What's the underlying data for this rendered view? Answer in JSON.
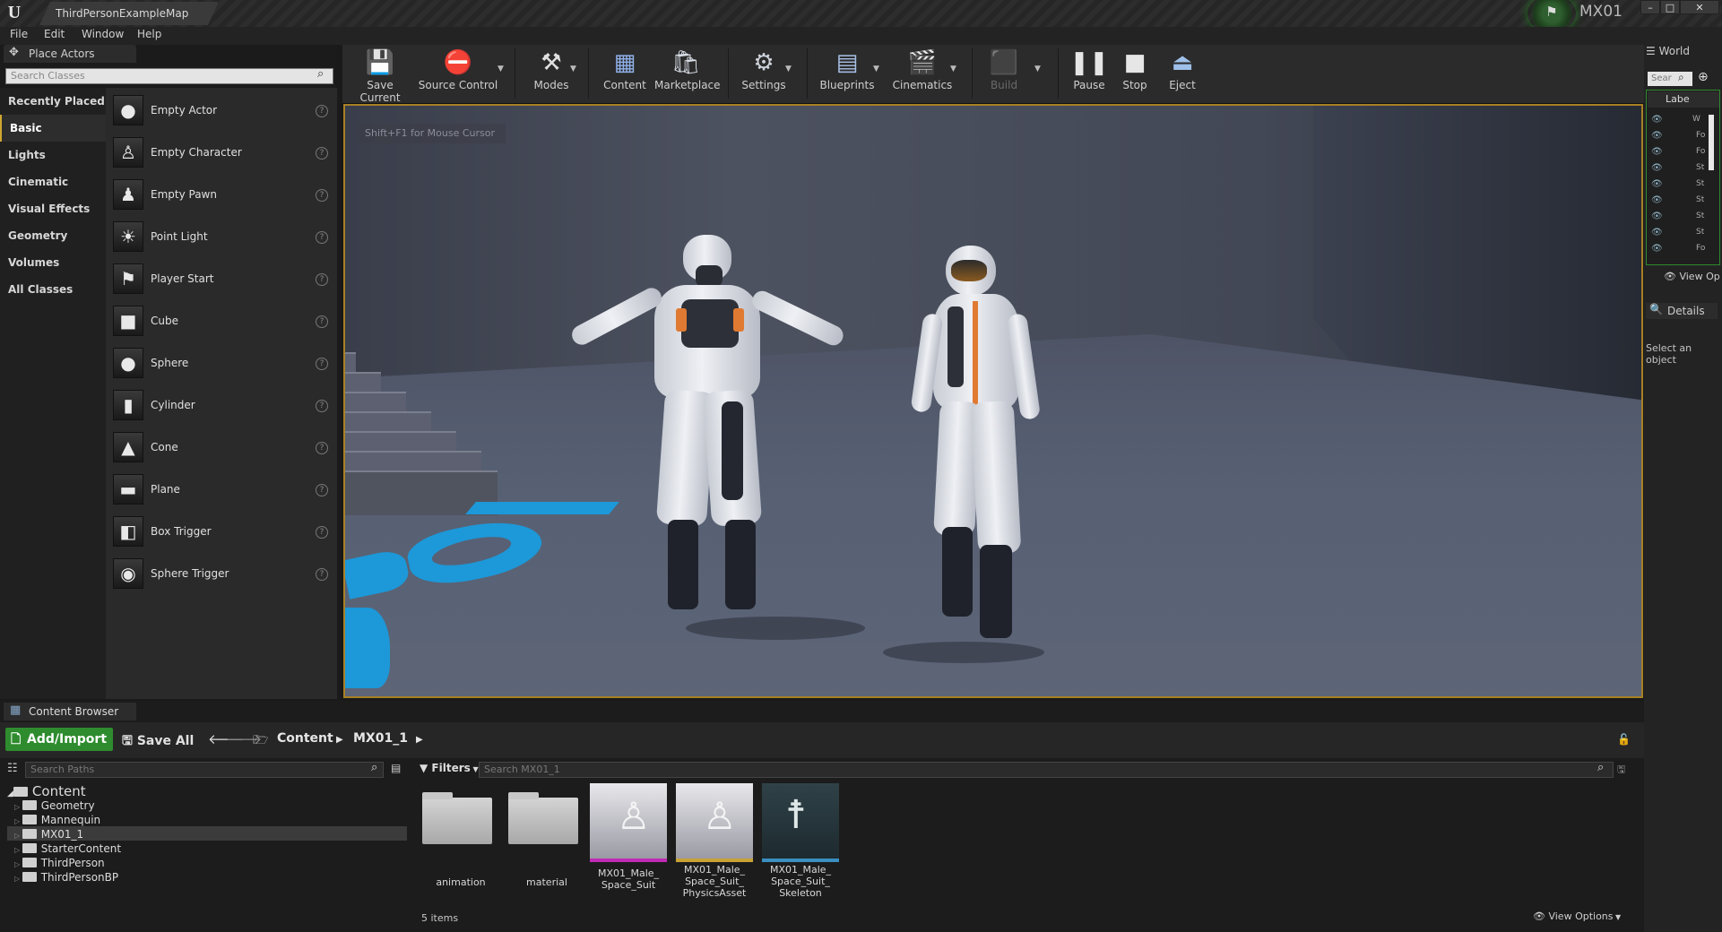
{
  "window": {
    "doc_tab": "ThirdPersonExampleMap",
    "project_name": "MX01",
    "controls": [
      "–",
      "□",
      "✕"
    ]
  },
  "menu": [
    "File",
    "Edit",
    "Window",
    "Help"
  ],
  "place_actors": {
    "tab_label": "Place Actors",
    "search_placeholder": "Search Classes",
    "categories": [
      "Recently Placed",
      "Basic",
      "Lights",
      "Cinematic",
      "Visual Effects",
      "Geometry",
      "Volumes",
      "All Classes"
    ],
    "selected_category": "Basic",
    "actors": [
      {
        "label": "Empty Actor",
        "icon": "sphere-icon"
      },
      {
        "label": "Empty Character",
        "icon": "character-icon"
      },
      {
        "label": "Empty Pawn",
        "icon": "pawn-icon"
      },
      {
        "label": "Point Light",
        "icon": "light-bulb-icon"
      },
      {
        "label": "Player Start",
        "icon": "player-start-icon"
      },
      {
        "label": "Cube",
        "icon": "cube-icon"
      },
      {
        "label": "Sphere",
        "icon": "sphere-icon"
      },
      {
        "label": "Cylinder",
        "icon": "cylinder-icon"
      },
      {
        "label": "Cone",
        "icon": "cone-icon"
      },
      {
        "label": "Plane",
        "icon": "plane-icon"
      },
      {
        "label": "Box Trigger",
        "icon": "box-trigger-icon"
      },
      {
        "label": "Sphere Trigger",
        "icon": "sphere-trigger-icon"
      }
    ]
  },
  "toolbar": {
    "items": [
      {
        "label": "Save Current",
        "icon": "save-icon"
      },
      {
        "label": "Source Control",
        "icon": "source-control-icon"
      },
      {
        "label": "Modes",
        "icon": "modes-icon"
      },
      {
        "label": "Content",
        "icon": "content-icon"
      },
      {
        "label": "Marketplace",
        "icon": "marketplace-icon"
      },
      {
        "label": "Settings",
        "icon": "settings-icon"
      },
      {
        "label": "Blueprints",
        "icon": "blueprints-icon"
      },
      {
        "label": "Cinematics",
        "icon": "cinematics-icon"
      },
      {
        "label": "Build",
        "icon": "build-icon"
      },
      {
        "label": "Pause",
        "icon": "pause-icon"
      },
      {
        "label": "Stop",
        "icon": "stop-icon"
      },
      {
        "label": "Eject",
        "icon": "eject-icon"
      }
    ]
  },
  "viewport": {
    "hint": "Shift+F1 for Mouse Cursor"
  },
  "world_outliner": {
    "tab_label": "World",
    "search_placeholder": "Sear",
    "column_label": "Labe",
    "rows": [
      "W",
      "Fo",
      "Fo",
      "St",
      "St",
      "St",
      "St",
      "St",
      "Fo"
    ],
    "view_options": "View Op"
  },
  "details": {
    "tab_label": "Details",
    "hint": "Select an object"
  },
  "content_browser": {
    "tab_label": "Content Browser",
    "add_import": "Add/Import",
    "save_all": "Save All",
    "breadcrumb": [
      "Content",
      "MX01_1"
    ],
    "path_search_placeholder": "Search Paths",
    "filters_label": "Filters",
    "asset_search_placeholder": "Search MX01_1",
    "tree_root": "Content",
    "tree": [
      "Geometry",
      "Mannequin",
      "MX01_1",
      "StarterContent",
      "ThirdPerson",
      "ThirdPersonBP"
    ],
    "selected_folder": "MX01_1",
    "assets": [
      {
        "name": "animation",
        "kind": "folder"
      },
      {
        "name": "material",
        "kind": "folder"
      },
      {
        "name": "MX01_Male_ Space_Suit",
        "kind": "skeletal-mesh",
        "accent": "#c02ab4"
      },
      {
        "name": "MX01_Male_ Space_Suit_ PhysicsAsset",
        "kind": "physics-asset",
        "accent": "#c8a234"
      },
      {
        "name": "MX01_Male_ Space_Suit_ Skeleton",
        "kind": "skeleton",
        "accent": "#3a8fc0"
      }
    ],
    "item_count": "5 items",
    "view_options": "View Options"
  },
  "colors": {
    "accent_green": "#2e8c2e",
    "viewport_border": "#a88024",
    "floor_decal": "#1d98d8"
  }
}
